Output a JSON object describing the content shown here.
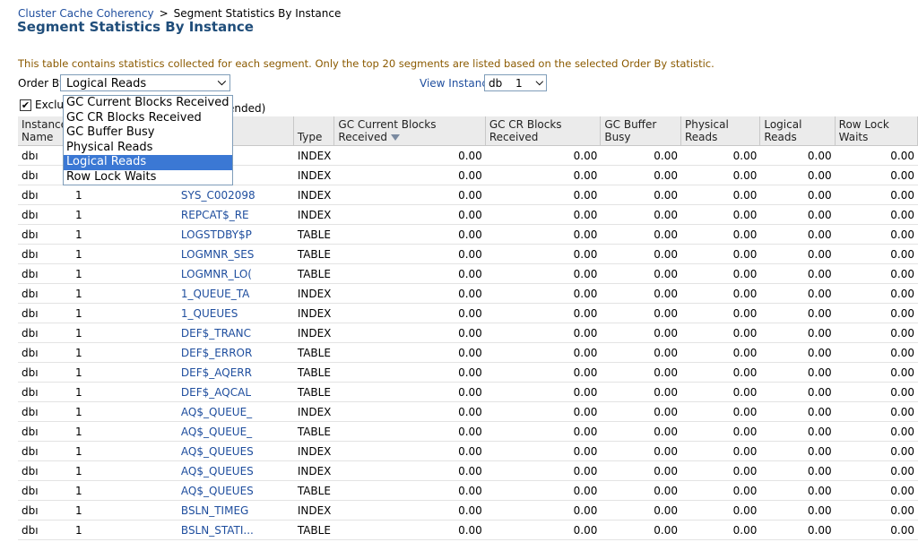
{
  "breadcrumb": {
    "parent": "Cluster Cache Coherency",
    "separator": ">",
    "current": "Segment Statistics By Instance"
  },
  "page_title": "Segment Statistics By Instance",
  "description": "This table contains statistics collected for each segment. Only the top 20 segments are listed based on the selected Order By statistic.",
  "order_by": {
    "label": "Order By",
    "selected": "Logical Reads",
    "options": [
      "GC Current Blocks Received",
      "GC CR Blocks Received",
      "GC Buffer Busy",
      "Physical Reads",
      "Logical Reads",
      "Row Lock Waits"
    ]
  },
  "view_instance": {
    "label": "View Instance",
    "db": "db",
    "num": "1"
  },
  "exclude": {
    "checked": "✔",
    "text": "Exclu",
    "tail": "ended)"
  },
  "table": {
    "headers": [
      "Instance Name",
      "",
      "",
      "Type",
      "GC Current Blocks Received",
      "GC CR Blocks Received",
      "GC Buffer Busy",
      "Physical Reads",
      "Logical Reads",
      "Row Lock Waits"
    ],
    "rows": [
      {
        "inst": "dbı",
        "num": "1",
        "obj": "",
        "type": "INDEX"
      },
      {
        "inst": "dbı",
        "num": "1",
        "obj": "",
        "type": "INDEX"
      },
      {
        "inst": "dbı",
        "num": "1",
        "obj": "SYS_C002098",
        "type": "INDEX"
      },
      {
        "inst": "dbı",
        "num": "1",
        "obj": "REPCAT$_RE",
        "type": "INDEX"
      },
      {
        "inst": "dbı",
        "num": "1",
        "obj": "LOGSTDBY$P",
        "type": "TABLE"
      },
      {
        "inst": "dbı",
        "num": "1",
        "obj": "LOGMNR_SES",
        "type": "TABLE"
      },
      {
        "inst": "dbı",
        "num": "1",
        "obj": "LOGMNR_LO(",
        "type": "TABLE"
      },
      {
        "inst": "dbı",
        "num": "1",
        "obj": "1_QUEUE_TA",
        "type": "INDEX"
      },
      {
        "inst": "dbı",
        "num": "1",
        "obj": "1_QUEUES",
        "type": "INDEX"
      },
      {
        "inst": "dbı",
        "num": "1",
        "obj": "DEF$_TRANC",
        "type": "INDEX"
      },
      {
        "inst": "dbı",
        "num": "1",
        "obj": "DEF$_ERROR",
        "type": "TABLE"
      },
      {
        "inst": "dbı",
        "num": "1",
        "obj": "DEF$_AQERR",
        "type": "TABLE"
      },
      {
        "inst": "dbı",
        "num": "1",
        "obj": "DEF$_AQCAL",
        "type": "TABLE"
      },
      {
        "inst": "dbı",
        "num": "1",
        "obj": "AQ$_QUEUE_",
        "type": "INDEX"
      },
      {
        "inst": "dbı",
        "num": "1",
        "obj": "AQ$_QUEUE_",
        "type": "TABLE"
      },
      {
        "inst": "dbı",
        "num": "1",
        "obj": "AQ$_QUEUES",
        "type": "INDEX"
      },
      {
        "inst": "dbı",
        "num": "1",
        "obj": "AQ$_QUEUES",
        "type": "INDEX"
      },
      {
        "inst": "dbı",
        "num": "1",
        "obj": "AQ$_QUEUES",
        "type": "TABLE"
      },
      {
        "inst": "dbı",
        "num": "1",
        "obj": "BSLN_TIMEG",
        "type": "INDEX"
      },
      {
        "inst": "dbı",
        "num": "1",
        "obj": "BSLN_STATI...",
        "type": "TABLE"
      }
    ],
    "value": "0.00"
  }
}
